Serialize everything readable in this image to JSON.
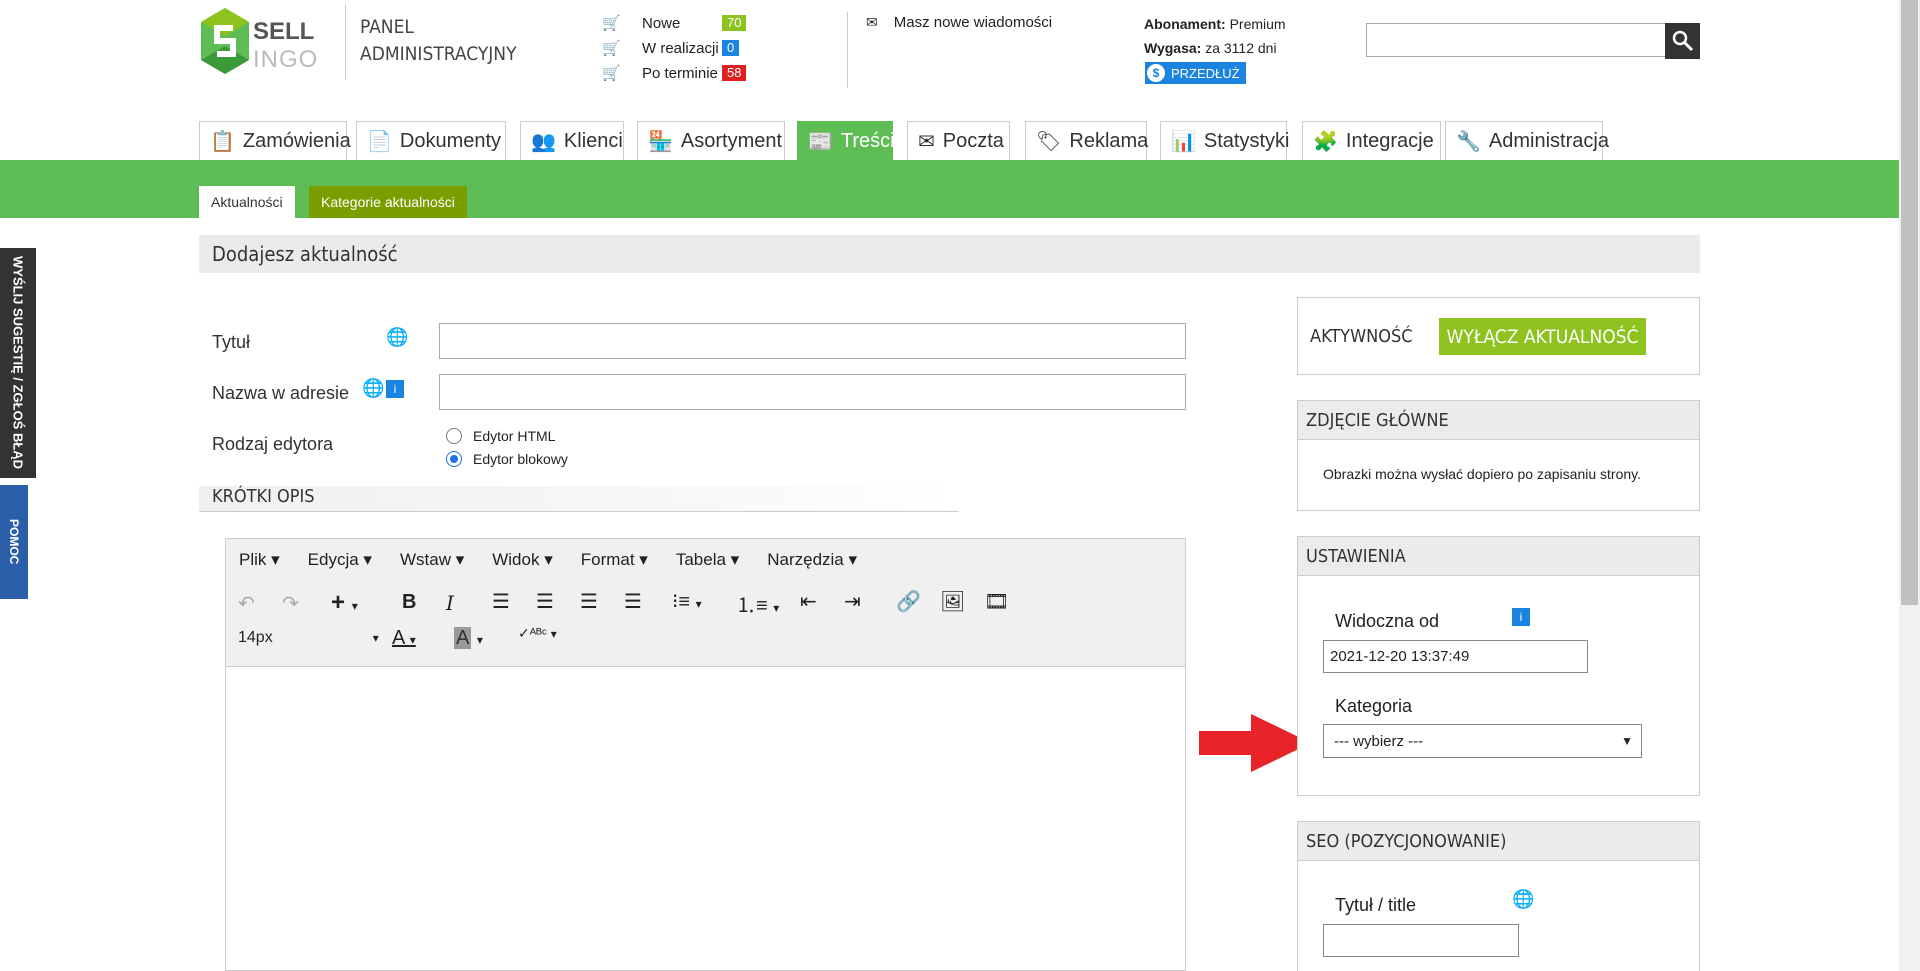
{
  "logo": {
    "line1": "SELL",
    "line2": "INGO"
  },
  "panel_title": {
    "line1": "PANEL",
    "line2": "ADMINISTRACYJNY"
  },
  "orders": [
    {
      "label": "Nowe",
      "count": "70",
      "color": "#8dc21f"
    },
    {
      "label": "W realizacji",
      "count": "0",
      "color": "#1a84e0"
    },
    {
      "label": "Po terminie",
      "count": "58",
      "color": "#e02020"
    }
  ],
  "messages": "Masz nowe wiadomości",
  "subscription": {
    "plan_label": "Abonament:",
    "plan": "Premium",
    "expires_label": "Wygasa:",
    "expires": "za 3112 dni",
    "renew": "PRZEDŁUŻ"
  },
  "nav": [
    {
      "label": "Zamówienia",
      "icon": "clipboard-icon"
    },
    {
      "label": "Dokumenty",
      "icon": "document-icon"
    },
    {
      "label": "Klienci",
      "icon": "people-icon"
    },
    {
      "label": "Asortyment",
      "icon": "store-icon"
    },
    {
      "label": "Treści",
      "icon": "content-icon"
    },
    {
      "label": "Poczta",
      "icon": "mail-icon"
    },
    {
      "label": "Reklama",
      "icon": "tag-icon"
    },
    {
      "label": "Statystyki",
      "icon": "chart-icon"
    },
    {
      "label": "Integracje",
      "icon": "puzzle-icon"
    },
    {
      "label": "Administracja",
      "icon": "wrench-icon"
    }
  ],
  "subtabs": [
    "Aktualności",
    "Kategorie aktualności"
  ],
  "side": {
    "suggest": "WYŚLIJ SUGESTIĘ / ZGŁOŚ BŁĄD",
    "help": "POMOC"
  },
  "page_title": "Dodajesz aktualność",
  "form": {
    "title_label": "Tytuł",
    "url_label": "Nazwa w adresie",
    "editor_label": "Rodzaj edytora",
    "editor_html": "Edytor HTML",
    "editor_block": "Edytor blokowy",
    "short_desc": "KRÓTKI OPIS"
  },
  "editor_menu": [
    "Plik",
    "Edycja",
    "Wstaw",
    "Widok",
    "Format",
    "Tabela",
    "Narzędzia"
  ],
  "font_size": "14px",
  "right": {
    "activity_label": "AKTYWNOŚĆ",
    "activity_btn": "WYŁĄCZ AKTUALNOŚĆ",
    "photo_head": "ZDJĘCIE GŁÓWNE",
    "photo_note": "Obrazki można wysłać dopiero po zapisaniu strony.",
    "settings_head": "USTAWIENIA",
    "visible_from_label": "Widoczna od",
    "visible_from": "2021-12-20 13:37:49",
    "category_label": "Kategoria",
    "category_value": "--- wybierz ---",
    "seo_head": "SEO (POZYCJONOWANIE)",
    "seo_title_label": "Tytuł / title"
  },
  "colors": {
    "green": "#5ebd55",
    "olive": "#7a9d00",
    "lime": "#8dc21f",
    "blue": "#1a84e0",
    "arrow": "#e8232a"
  }
}
